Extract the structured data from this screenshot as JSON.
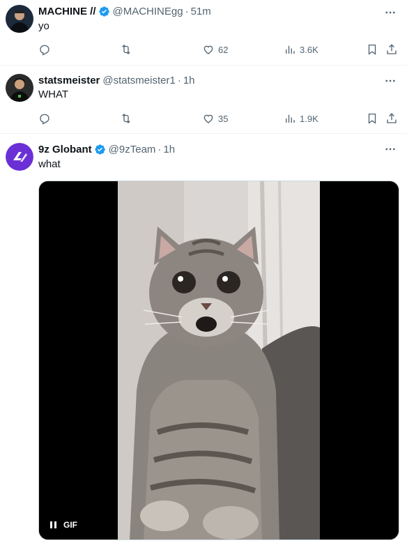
{
  "posts": [
    {
      "name": "MACHINE //",
      "handle": "@MACHINEgg",
      "time": "51m",
      "text": "yo",
      "verified": true,
      "avatar_icon": "person-avatar",
      "likes": "62",
      "views": "3.6K"
    },
    {
      "name": "statsmeister",
      "handle": "@statsmeister1",
      "time": "1h",
      "text": "WHAT",
      "verified": false,
      "avatar_icon": "person-avatar",
      "likes": "35",
      "views": "1.9K"
    },
    {
      "name": "9z Globant",
      "handle": "@9zTeam",
      "time": "1h",
      "text": "what",
      "verified": true,
      "avatar_icon": "9z-logo",
      "media": {
        "type": "gif",
        "label": "GIF",
        "subject": "surprised-cat"
      }
    }
  ],
  "separator": "·",
  "colors": {
    "verified": "#1d9bf0",
    "muted": "#536471",
    "text": "#0f1419",
    "team_logo": "#6b2fd6"
  }
}
